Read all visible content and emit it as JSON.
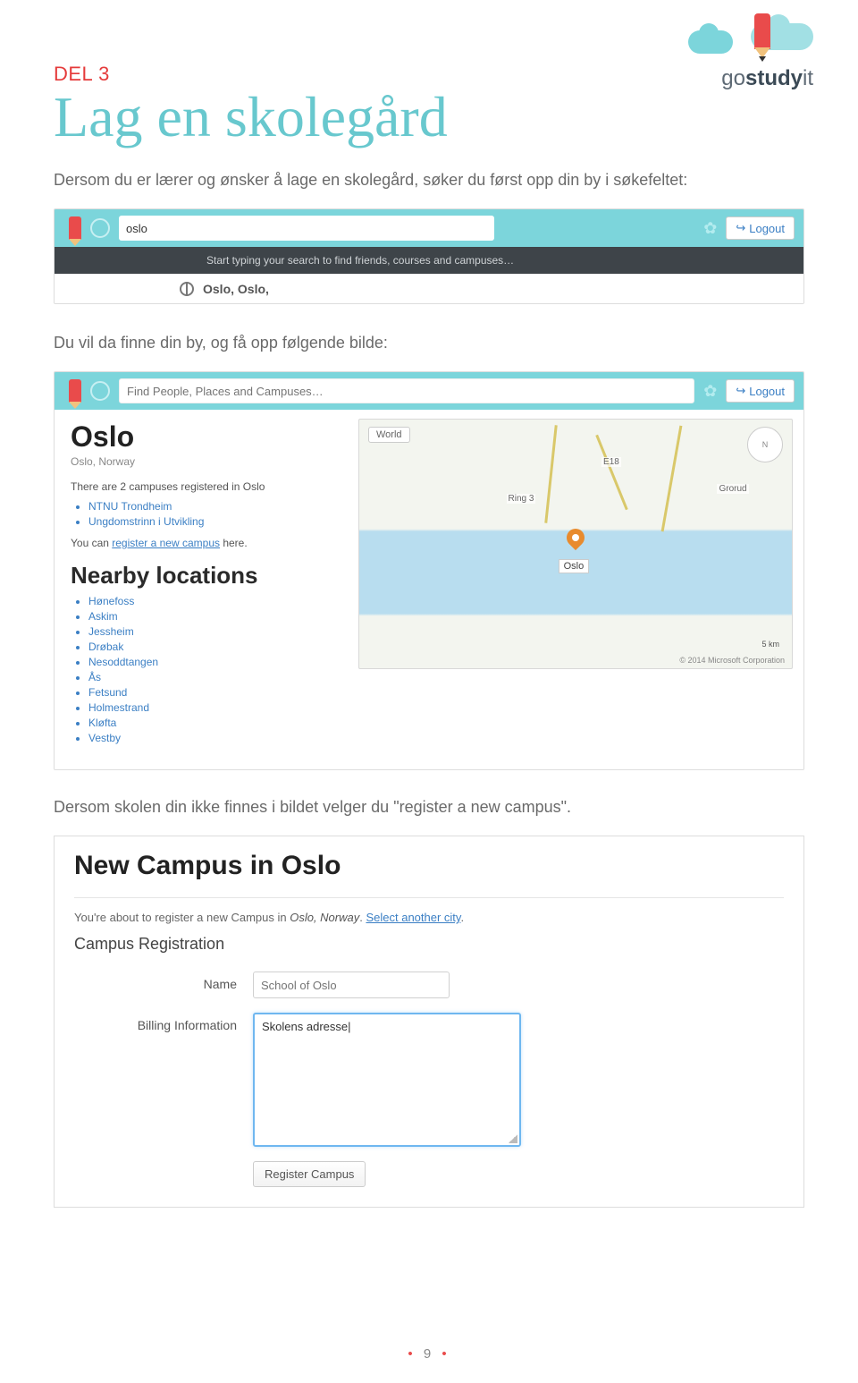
{
  "logo": {
    "go": "go",
    "study": "study",
    "it": "it"
  },
  "part_label": "DEL 3",
  "title": "Lag en skolegård",
  "para1": "Dersom du er lærer og ønsker å lage en skolegård, søker du først opp din by i søkefeltet:",
  "para2": "Du vil da finne din by, og få opp følgende bilde:",
  "para3_a": "Dersom skolen din ikke finnes i bildet velger du \"",
  "para3_link": "register a new campus",
  "para3_b": "\".",
  "shot1": {
    "search_value": "oslo",
    "hint": "Start typing your search to find friends, courses and campuses…",
    "suggestion": "Oslo, Oslo,",
    "logout": "Logout"
  },
  "shot2": {
    "search_placeholder": "Find People, Places and Campuses…",
    "logout": "Logout",
    "city": "Oslo",
    "city_sub": "Oslo, Norway",
    "count_line": "There are 2 campuses registered in Oslo",
    "campuses": [
      "NTNU Trondheim",
      "Ungdomstrinn i Utvikling"
    ],
    "reg_a": "You can ",
    "reg_link": "register a new campus",
    "reg_b": " here.",
    "nearby_title": "Nearby locations",
    "nearby": [
      "Hønefoss",
      "Askim",
      "Jessheim",
      "Drøbak",
      "Nesoddtangen",
      "Ås",
      "Fetsund",
      "Holmestrand",
      "Kløfta",
      "Vestby"
    ],
    "map": {
      "world": "World",
      "compass": "N",
      "city_label": "Oslo",
      "labels": {
        "ring3": "Ring 3",
        "e18": "E18",
        "grorud": "Grorud"
      },
      "scale": "5 km",
      "footer": "© 2014 Microsoft Corporation"
    }
  },
  "shot3": {
    "title": "New Campus in Oslo",
    "intro_a": "You're about to register a new Campus in ",
    "intro_city": "Oslo, Norway",
    "intro_b": ". ",
    "intro_link": "Select another city",
    "intro_c": ".",
    "section": "Campus Registration",
    "name_label": "Name",
    "name_placeholder": "School of Oslo",
    "billing_label": "Billing Information",
    "billing_value": "Skolens adresse",
    "button": "Register Campus"
  },
  "page_number": "9"
}
